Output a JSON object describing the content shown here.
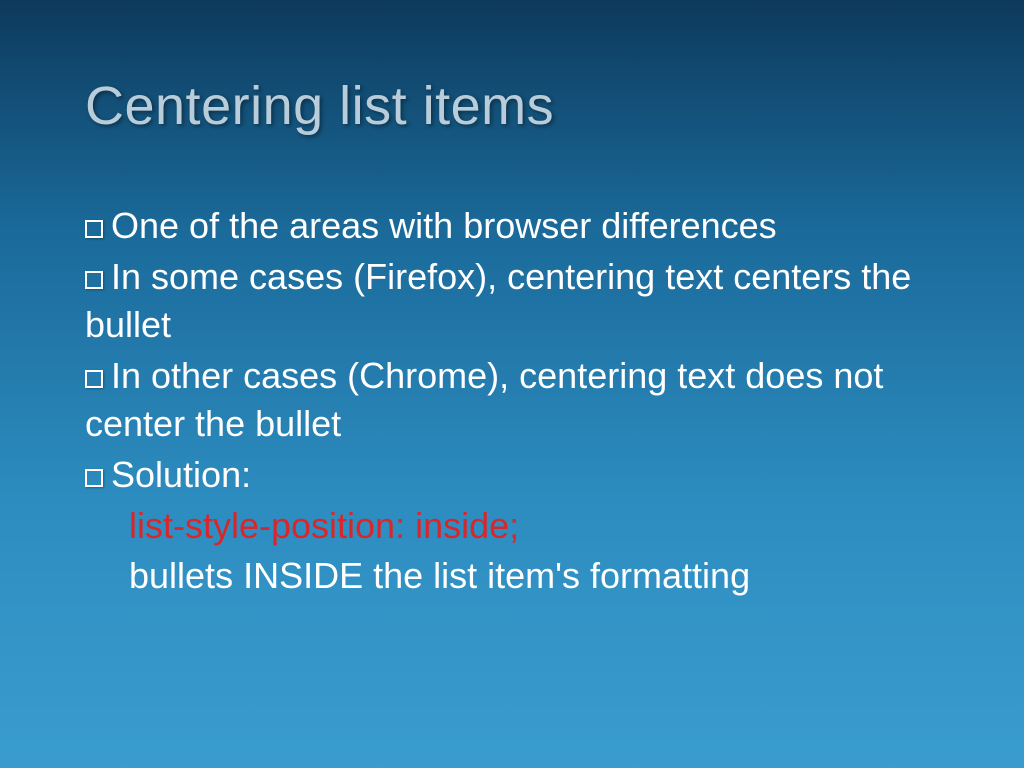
{
  "title": "Centering list items",
  "bullets": {
    "item1": "One of the areas with browser differences",
    "item2": "In some cases (Firefox), centering text centers the bullet",
    "item3": "In other cases (Chrome), centering text does not center the bullet",
    "item4": "Solution:",
    "code1": "list-style-position: inside;",
    "code2": "bullets INSIDE the list item's formatting"
  }
}
